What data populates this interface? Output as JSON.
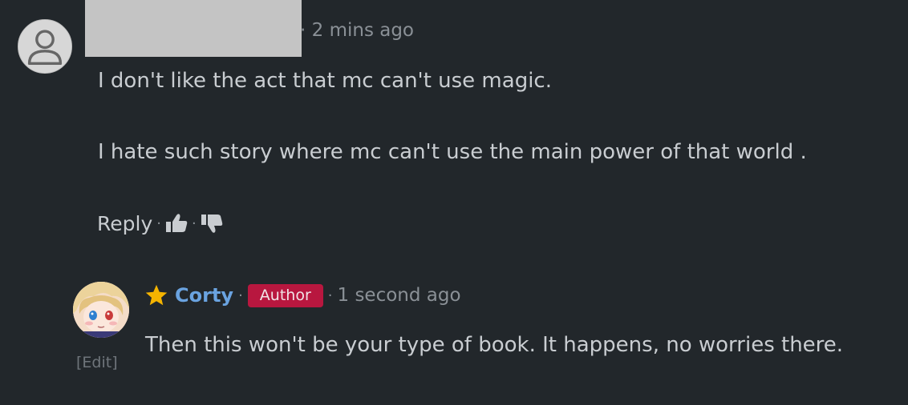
{
  "comment": {
    "timestamp": "2 mins ago",
    "lines": [
      "I don't like the act that mc can't use magic.",
      "I hate such story where mc can't use the main power of that world ."
    ],
    "actions": {
      "reply_label": "Reply",
      "separator": "·",
      "like_icon": "thumbs-up-icon",
      "dislike_icon": "thumbs-down-icon"
    },
    "avatar_icon": "default-user-avatar"
  },
  "reply": {
    "author": "Corty",
    "badge": "Author",
    "timestamp": "1 second ago",
    "text": "Then this won't be your type of book. It happens, no worries there.",
    "edit_label": "[Edit]",
    "separator": "·",
    "star_icon": "star-icon",
    "colors": {
      "author_name": "#6aa3e0",
      "badge_bg": "#b8173f",
      "star": "#f5b400"
    }
  }
}
